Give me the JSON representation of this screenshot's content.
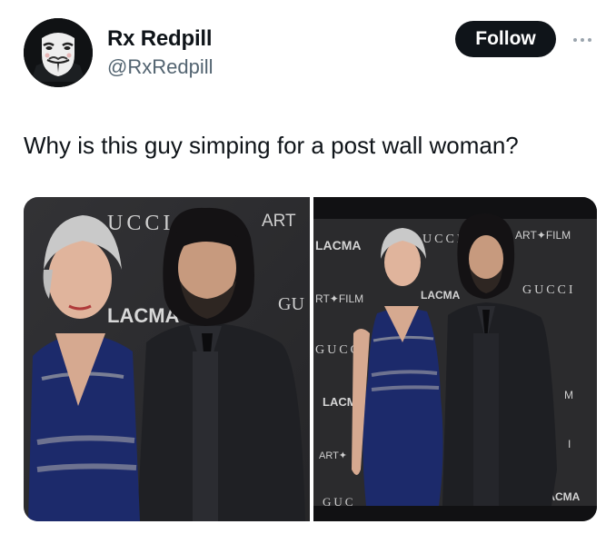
{
  "author": {
    "display_name": "Rx Redpill",
    "handle": "@RxRedpill",
    "avatar_icon": "guy-fawkes-mask-icon"
  },
  "actions": {
    "follow_label": "Follow",
    "more_icon": "more-horizontal-icon"
  },
  "tweet": {
    "text": "Why is this guy simping for a post wall woman?"
  },
  "media": {
    "photo_1": {
      "backdrop_text": [
        "UCCI",
        "ART",
        "LACMA",
        "GU"
      ]
    },
    "photo_2": {
      "backdrop_text": [
        "LACMA",
        "UCCI",
        "ART✦FILM",
        "RT✦FILM",
        "LACMA",
        "GUCCI",
        "GUCC",
        "LACM",
        "ART✦",
        "GUC",
        "LACMA",
        "M",
        "I"
      ]
    }
  },
  "colors": {
    "follow_bg": "#0f1419",
    "handle_gray": "#536471",
    "backdrop": "#2b2b2d",
    "dress_blue": "#1c2a6b"
  }
}
